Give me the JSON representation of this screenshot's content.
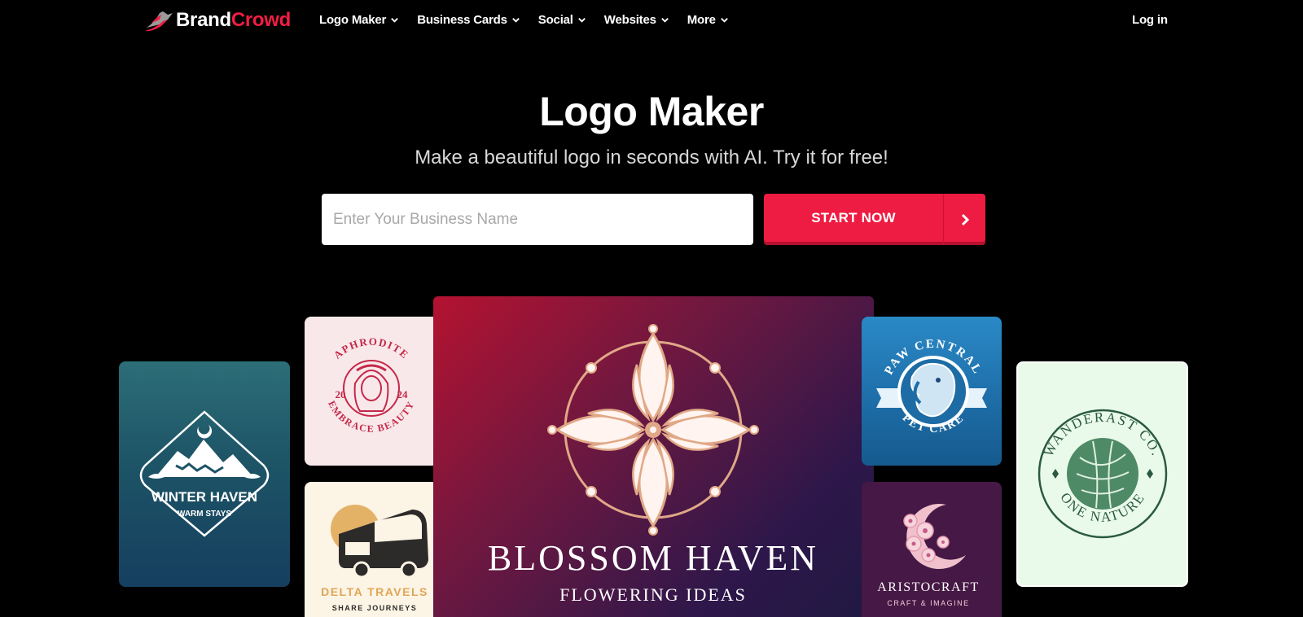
{
  "brand": {
    "part1": "Brand",
    "part2": "Crowd",
    "accent": "#f21d43"
  },
  "nav": {
    "items": [
      {
        "label": "Logo Maker",
        "icon": "chevron-down-icon"
      },
      {
        "label": "Business Cards",
        "icon": "chevron-down-icon"
      },
      {
        "label": "Social",
        "icon": "chevron-down-icon"
      },
      {
        "label": "Websites",
        "icon": "chevron-down-icon"
      },
      {
        "label": "More",
        "icon": "chevron-down-icon"
      }
    ],
    "login": "Log in"
  },
  "hero": {
    "title": "Logo Maker",
    "subtitle": "Make a beautiful logo in seconds with AI. Try it for free!",
    "input_placeholder": "Enter Your Business Name",
    "input_value": "",
    "cta_label": "START NOW",
    "cta_icon": "chevron-right-icon",
    "cta_color": "#ee1b42"
  },
  "logos": {
    "winter": {
      "name": "WINTER HAVEN",
      "tagline": "WARM STAYS"
    },
    "aphrodite": {
      "name": "APHRODITE",
      "tagline": "EMBRACE BEAUTY",
      "year_left": "20",
      "year_right": "24"
    },
    "delta": {
      "name": "DELTA TRAVELS",
      "tagline": "SHARE JOURNEYS"
    },
    "blossom": {
      "name": "BLOSSOM HAVEN",
      "tagline": "FLOWERING IDEAS"
    },
    "paw": {
      "name": "PAW CENTRAL",
      "tagline": "PET CARE"
    },
    "aristo": {
      "name": "ARISTOCRAFT",
      "tagline": "CRAFT & IMAGINE"
    },
    "wander": {
      "name": "WANDERAST CO.",
      "tagline": "ONE NATURE"
    }
  }
}
